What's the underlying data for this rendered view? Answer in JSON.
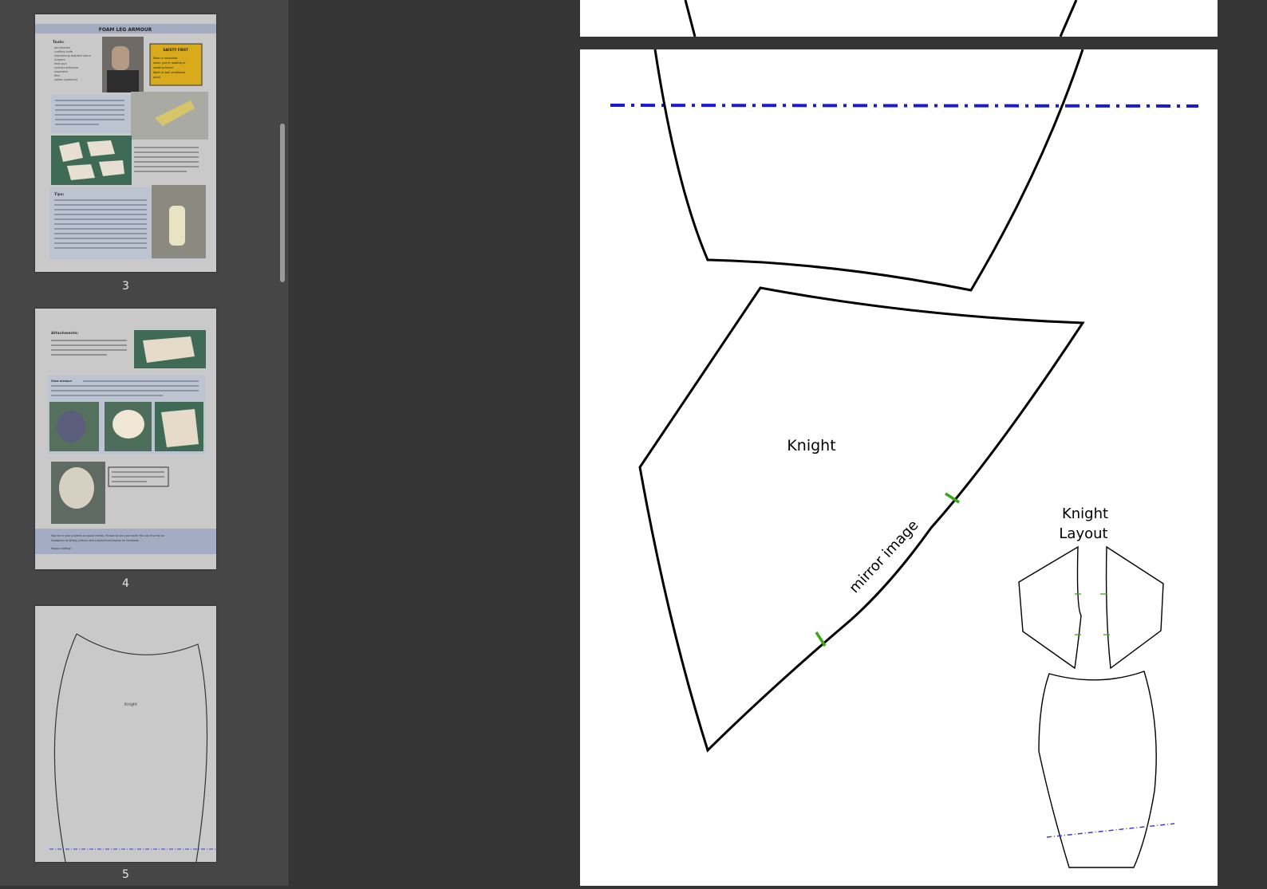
{
  "sidebar": {
    "thumbnails": [
      {
        "page_number": "3",
        "title": "FOAM LEG ARMOUR",
        "safety_heading": "SAFETY FIRST",
        "safety_lines": [
          "Wear a respirator",
          "when you're heating or",
          "sanding foam!",
          "Work in well ventilated",
          "area!"
        ],
        "tools_heading": "Tools:",
        "tools_items": [
          "pen/marker",
          "crafting knife",
          "sharpening tool/wet stone",
          "scissors",
          "heat gun",
          "contact adhesive",
          "respirator",
          "files",
          "spikes (optional)"
        ],
        "tips_heading": "Tips:"
      },
      {
        "page_number": "4",
        "attachments_heading": "Attachments:",
        "shoe_heading": "Shoe armour:",
        "footer_line_1": "Tag me in your projects on social media, I'd love to see your work! You can find me on",
        "footer_line_2": "Instagram as @lady_arthurs and LadyArthursCosplay on Facebook.",
        "footer_line_3": "Happy crafting!"
      },
      {
        "page_number": "5",
        "piece_label": "Knight"
      }
    ]
  },
  "document": {
    "main_piece_label": "Knight",
    "mirror_label": "mirror image",
    "layout_label_line1": "Knight",
    "layout_label_line2": "Layout"
  },
  "colors": {
    "cut_line": "#000000",
    "alignment_line": "#1a1ad6",
    "notch_mark": "#3aa81a",
    "sidebar_bg": "#464646",
    "viewer_bg": "#353535"
  }
}
